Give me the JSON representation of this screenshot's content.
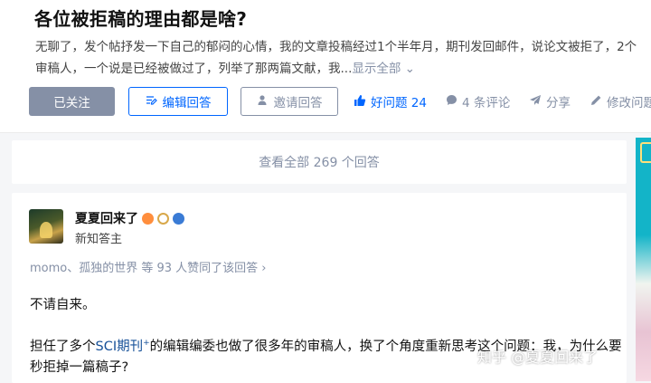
{
  "question": {
    "title": "各位被拒稿的理由都是啥?",
    "excerpt": "无聊了，发个帖抒发一下自己的郁闷的心情，我的文章投稿经过1个半年月，期刊发回邮件，说论文被拒了，2个审稿人，一个说是已经被做过了，列举了那两篇文献，我...",
    "show_all": "显示全部",
    "chevron": "⌄"
  },
  "toolbar": {
    "followed": "已关注",
    "write_answer": "编辑回答",
    "invite": "邀请回答",
    "good_question": "好问题 24",
    "comments": "4 条评论",
    "share": "分享",
    "edit_question": "修改问题"
  },
  "answers_bar": {
    "label": "查看全部 269 个回答"
  },
  "answer": {
    "author_name": "夏夏回来了",
    "author_desc": "新知答主",
    "voters": "momo、孤独的世界 等 93 人赞同了该回答 ›",
    "para1": "不请自来。",
    "para2_prefix": "担任了多个",
    "para2_link": "SCI期刊",
    "para2_sup": "+",
    "para2_rest": "的编辑编委也做了很多年的审稿人，换了个角度重新思考这个问题：我，为什么要秒拒掉一篇稿子?"
  },
  "watermark": "知乎 @夏夏回来了",
  "colors": {
    "primary": "#0066ff",
    "muted": "#8590a6",
    "background": "#f5f6f8"
  },
  "icons": {
    "write": "pen-icon",
    "invite": "person-add-icon",
    "good": "thumb-up-icon",
    "comment": "comment-bubble-icon",
    "share": "paper-plane-icon",
    "edit": "pencil-icon"
  }
}
